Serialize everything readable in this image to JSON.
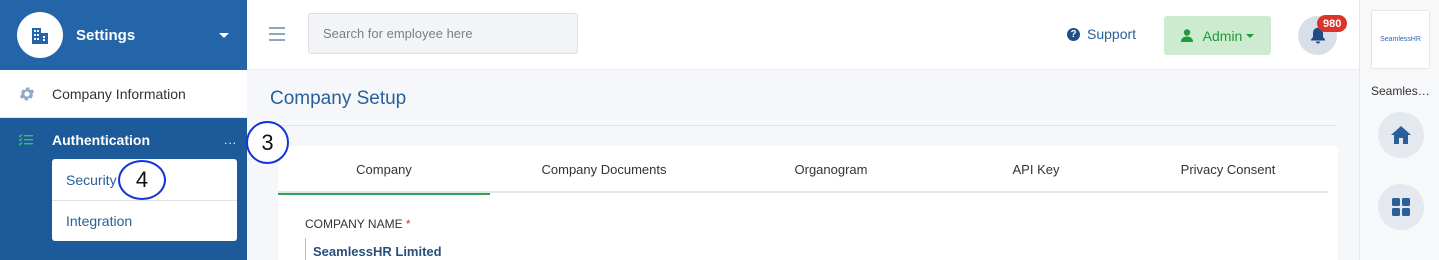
{
  "sidebar": {
    "title": "Settings",
    "items": [
      {
        "label": "Company Information"
      },
      {
        "label": "Authentication",
        "more": "..."
      }
    ],
    "submenu": [
      {
        "label": "Security"
      },
      {
        "label": "Integration"
      }
    ]
  },
  "topbar": {
    "search_placeholder": "Search for employee here",
    "support_label": "Support",
    "admin_label": "Admin",
    "notification_count": "980"
  },
  "main": {
    "page_title": "Company Setup",
    "tabs": [
      {
        "label": "Company",
        "active": true
      },
      {
        "label": "Company Documents"
      },
      {
        "label": "Organogram"
      },
      {
        "label": "API Key"
      },
      {
        "label": "Privacy Consent"
      }
    ],
    "field_label": "COMPANY NAME",
    "field_required": "*",
    "field_value": "SeamlessHR Limited"
  },
  "rail": {
    "logo_text": "SeamlessHR",
    "company_name": "Seamless..."
  },
  "annotations": [
    "3",
    "4"
  ],
  "colors": {
    "sidebar_bg": "#1d5a9a",
    "accent_blue": "#2a5f99",
    "admin_green": "#1e9a3c",
    "badge_red": "#d9352b",
    "active_tab": "#2ea44f"
  }
}
